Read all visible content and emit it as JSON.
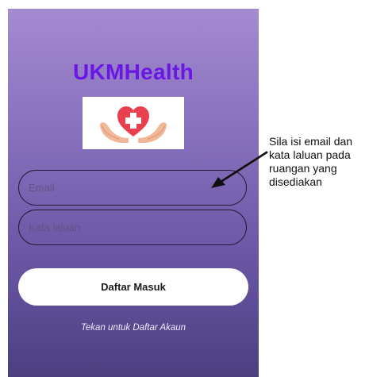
{
  "app": {
    "title": "UKMHealth",
    "logo_icon": "heart-plus-hands-icon"
  },
  "form": {
    "email_placeholder": "Email",
    "password_placeholder": "Kata laluan",
    "login_label": "Daftar Masuk",
    "register_link": "Tekan untuk Daftar Akaun"
  },
  "annotation": {
    "text": "Sila isi email dan\nkata laluan pada\nruangan yang\ndisediakan",
    "arrow_icon": "arrow-icon"
  },
  "colors": {
    "title": "#6a17e6",
    "gradient_top": "#a48ad0",
    "gradient_bottom": "#4c3f80",
    "heart": "#e8404e",
    "hands": "#f0b898"
  }
}
